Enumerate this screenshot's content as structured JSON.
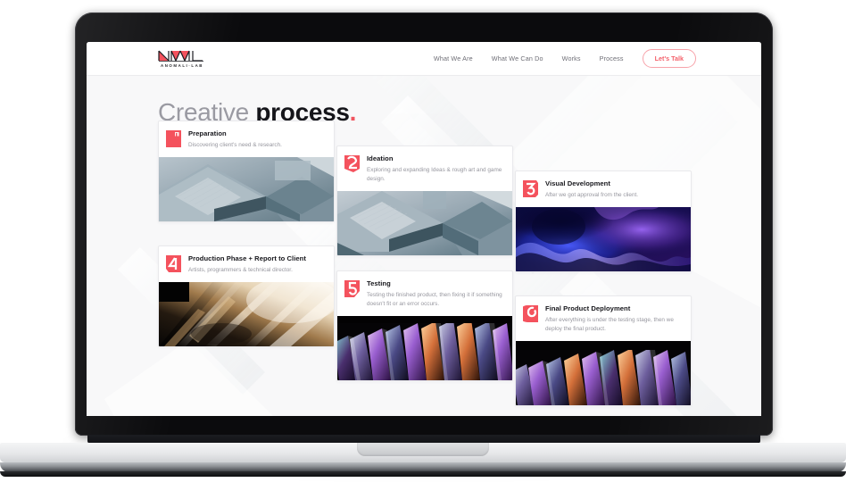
{
  "site": {
    "logo": {
      "wordmark": "ANOMALI·LAB",
      "mark_letters": "NML"
    },
    "nav": {
      "items": [
        {
          "label": "What We Are"
        },
        {
          "label": "What We Can Do"
        },
        {
          "label": "Works"
        },
        {
          "label": "Process"
        }
      ],
      "cta": {
        "label": "Let's Talk"
      }
    },
    "heading": {
      "light": "Creative",
      "bold": "process",
      "dot": "."
    },
    "cards": [
      {
        "number": "1",
        "title": "Preparation",
        "description": "Discovering client's need & research.",
        "image_alt": "isometric-architecture-render"
      },
      {
        "number": "2",
        "title": "Ideation",
        "description": "Exploring and expanding Ideas & rough art and game design.",
        "image_alt": "isometric-architecture-render"
      },
      {
        "number": "3",
        "title": "Visual Development",
        "description": "After we got approval from the client.",
        "image_alt": "blue-purple-fluid-abstract"
      },
      {
        "number": "4",
        "title": "Production Phase + Report to Client",
        "description": "Artists, programmers & technical director.",
        "image_alt": "golden-motion-blur-light-streaks"
      },
      {
        "number": "5",
        "title": "Testing",
        "description": "Testing the finished product, then fixing it if something doesn't fit or an error occurs.",
        "image_alt": "iridescent-glass-prisms-on-black"
      },
      {
        "number": "6",
        "title": "Final Product Deployment",
        "description": "After everything is under the testing stage, then we deploy the final product.",
        "image_alt": "iridescent-glass-prisms-on-black"
      }
    ],
    "colors": {
      "accent_red": "#f0545f",
      "badge_red": "#f4525d",
      "title_dark": "#15151a",
      "muted_gray": "#97979f",
      "page_bg": "#f8f8f9"
    }
  }
}
